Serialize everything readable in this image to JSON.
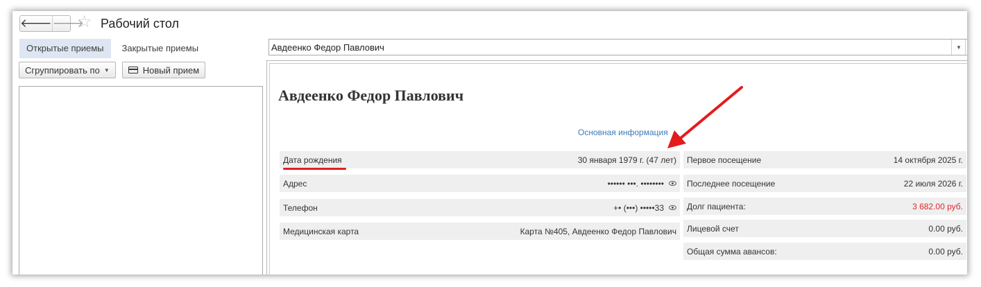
{
  "window": {
    "title": "Рабочий стол"
  },
  "nav": {
    "back_glyph": "🡐",
    "forward_glyph": "🡒",
    "star_glyph": "☆"
  },
  "tabs": [
    {
      "label": "Открытые приемы",
      "active": true
    },
    {
      "label": "Закрытые приемы",
      "active": false
    }
  ],
  "toolbar": {
    "group_label": "Сгруппировать по",
    "new_label": "Новый прием"
  },
  "patient_select": {
    "value": "Авдеенко Федор Павлович"
  },
  "patient": {
    "name": "Авдеенко Федор Павлович",
    "section_link": "Основная информация",
    "left_fields": [
      {
        "label": "Дата рождения",
        "value": "30 января 1979 г. (47 лет)"
      },
      {
        "label": "Адрес",
        "value": "•••••• •••. ••••••••"
      },
      {
        "label": "Телефон",
        "value": "+• (•••) •••••33"
      },
      {
        "label": "Медицинская карта",
        "value": "Карта №405, Авдеенко Федор Павлович"
      }
    ],
    "right_fields": [
      {
        "label": "Первое посещение",
        "value": "14 октября 2025 г."
      },
      {
        "label": "Последнее посещение",
        "value": "22 июля 2026 г."
      },
      {
        "label": "Долг пациента:",
        "value": "3 682.00 руб."
      },
      {
        "label": "Лицевой счет",
        "value": "0.00 руб."
      },
      {
        "label": "Общая сумма авансов:",
        "value": "0.00 руб."
      }
    ]
  },
  "colors": {
    "accent_link": "#3d7ab8",
    "debt_red": "#e0262b",
    "annotation_red": "#e41b1b",
    "active_tab": "#dde6f2"
  }
}
